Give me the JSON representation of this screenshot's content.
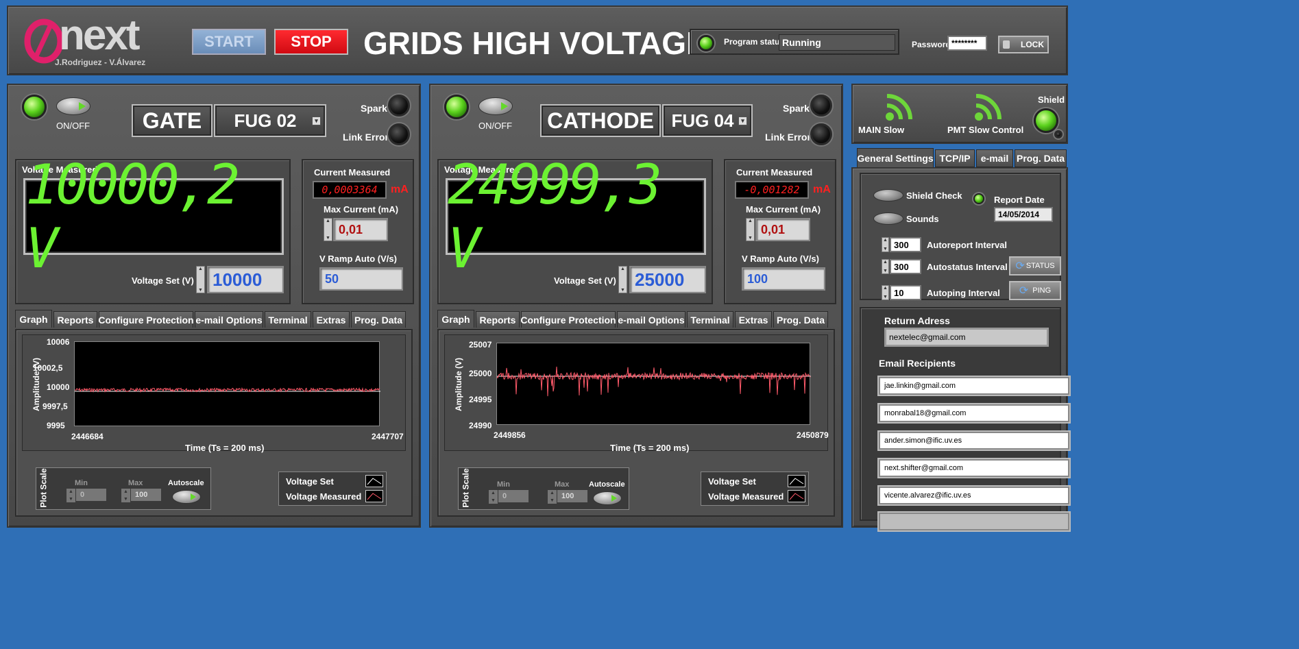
{
  "header": {
    "logo_text": "next",
    "authors": "J.Rodriguez - V.Álvarez",
    "start_label": "START",
    "stop_label": "STOP",
    "title": "GRIDS HIGH VOLTAGE",
    "program_status_label": "Program status",
    "program_status_value": "Running",
    "password_label": "Password",
    "password_value": "********",
    "lock_label": "LOCK"
  },
  "gate": {
    "onoff_label": "ON/OFF",
    "name": "GATE",
    "device": "FUG 02",
    "spark_label": "Spark",
    "link_error_label": "Link Error",
    "voltage_measured_label": "Voltage Measured",
    "voltage_measured_value": "10000,2 V",
    "voltage_set_label": "Voltage Set (V)",
    "voltage_set_value": "10000",
    "current_measured_label": "Current Measured",
    "current_measured_value": "0,0003364",
    "current_unit": "mA",
    "max_current_label": "Max Current (mA)",
    "max_current_value": "0,01",
    "v_ramp_label": "V Ramp Auto (V/s)",
    "v_ramp_value": "50",
    "tabs": [
      "Graph",
      "Reports",
      "Configure Protection",
      "e-mail Options",
      "Terminal",
      "Extras",
      "Prog. Data"
    ],
    "graph": {
      "y_label": "Amplitude (V)",
      "y_ticks": [
        "10006",
        "10002,5",
        "10000",
        "9997,5",
        "9995"
      ],
      "x_start": "2446684",
      "x_end": "2447707",
      "x_label": "Time (Ts = 200 ms)"
    },
    "plot_scale_label": "Plot Scale",
    "min_label": "Min",
    "min_value": "0",
    "max_label": "Max",
    "max_value": "100",
    "autoscale_label": "Autoscale",
    "legend": [
      "Voltage Set",
      "Voltage Measured"
    ]
  },
  "cathode": {
    "onoff_label": "ON/OFF",
    "name": "CATHODE",
    "device": "FUG 04",
    "spark_label": "Spark",
    "link_error_label": "Link Error",
    "voltage_measured_label": "Voltage Measured",
    "voltage_measured_value": "24999,3 V",
    "voltage_set_label": "Voltage Set (V)",
    "voltage_set_value": "25000",
    "current_measured_label": "Current Measured",
    "current_measured_value": "-0,001282",
    "current_unit": "mA",
    "max_current_label": "Max Current (mA)",
    "max_current_value": "0,01",
    "v_ramp_label": "V Ramp Auto (V/s)",
    "v_ramp_value": "100",
    "tabs": [
      "Graph",
      "Reports",
      "Configure Protection",
      "e-mail Options",
      "Terminal",
      "Extras",
      "Prog. Data"
    ],
    "graph": {
      "y_label": "Amplitude (V)",
      "y_ticks": [
        "25007",
        "25000",
        "24995",
        "24990"
      ],
      "x_start": "2449856",
      "x_end": "2450879",
      "x_label": "Time (Ts = 200 ms)"
    },
    "plot_scale_label": "Plot Scale",
    "min_label": "Min",
    "min_value": "0",
    "max_label": "Max",
    "max_value": "100",
    "autoscale_label": "Autoscale",
    "legend": [
      "Voltage Set",
      "Voltage Measured"
    ]
  },
  "right": {
    "main_slow_label": "MAIN Slow",
    "pmt_label": "PMT Slow Control",
    "shield_label": "Shield",
    "tabs": [
      "General Settings",
      "TCP/IP",
      "e-mail",
      "Prog. Data"
    ],
    "shield_check_label": "Shield Check",
    "sounds_label": "Sounds",
    "report_date_label": "Report Date",
    "report_date_value": "14/05/2014",
    "autoreport_label": "Autoreport Interval",
    "autoreport_value": "300",
    "autostatus_label": "Autostatus Interval",
    "autostatus_value": "300",
    "autoping_label": "Autoping Interval",
    "autoping_value": "10",
    "status_btn": "STATUS",
    "ping_btn": "PING",
    "return_address_label": "Return Adress",
    "return_address_value": "nextelec@gmail.com",
    "email_recipients_label": "Email Recipients",
    "recipients": [
      "jae.linkin@gmail.com",
      "monrabal18@gmail.com",
      "ander.simon@ific.uv.es",
      "next.shifter@gmail.com",
      "vicente.alvarez@ific.uv.es",
      ""
    ]
  },
  "colors": {
    "accent_green": "#6cf232",
    "stop_red": "#e8121c",
    "start_blue": "#7b9cc4",
    "background_blue": "#2f6fb6",
    "trace_red": "#ff5a6a"
  }
}
